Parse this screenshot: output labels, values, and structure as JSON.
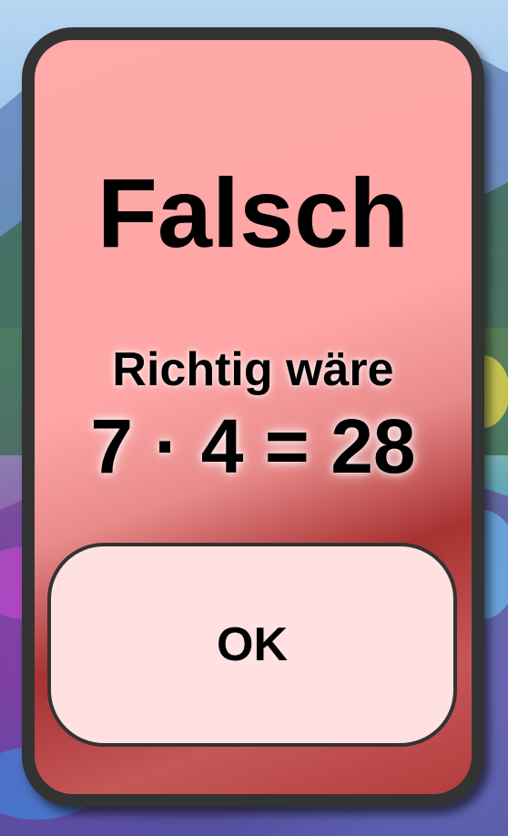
{
  "dialog": {
    "title": "Falsch",
    "hint_label": "Richtig wäre",
    "equation": "7 · 4 = 28",
    "ok_label": "OK"
  },
  "colors": {
    "dialog_top": "#ffa9a9",
    "dialog_bottom": "#b33d3d",
    "border": "#333333",
    "button_fill": "#ffe1e1",
    "text": "#000000"
  }
}
